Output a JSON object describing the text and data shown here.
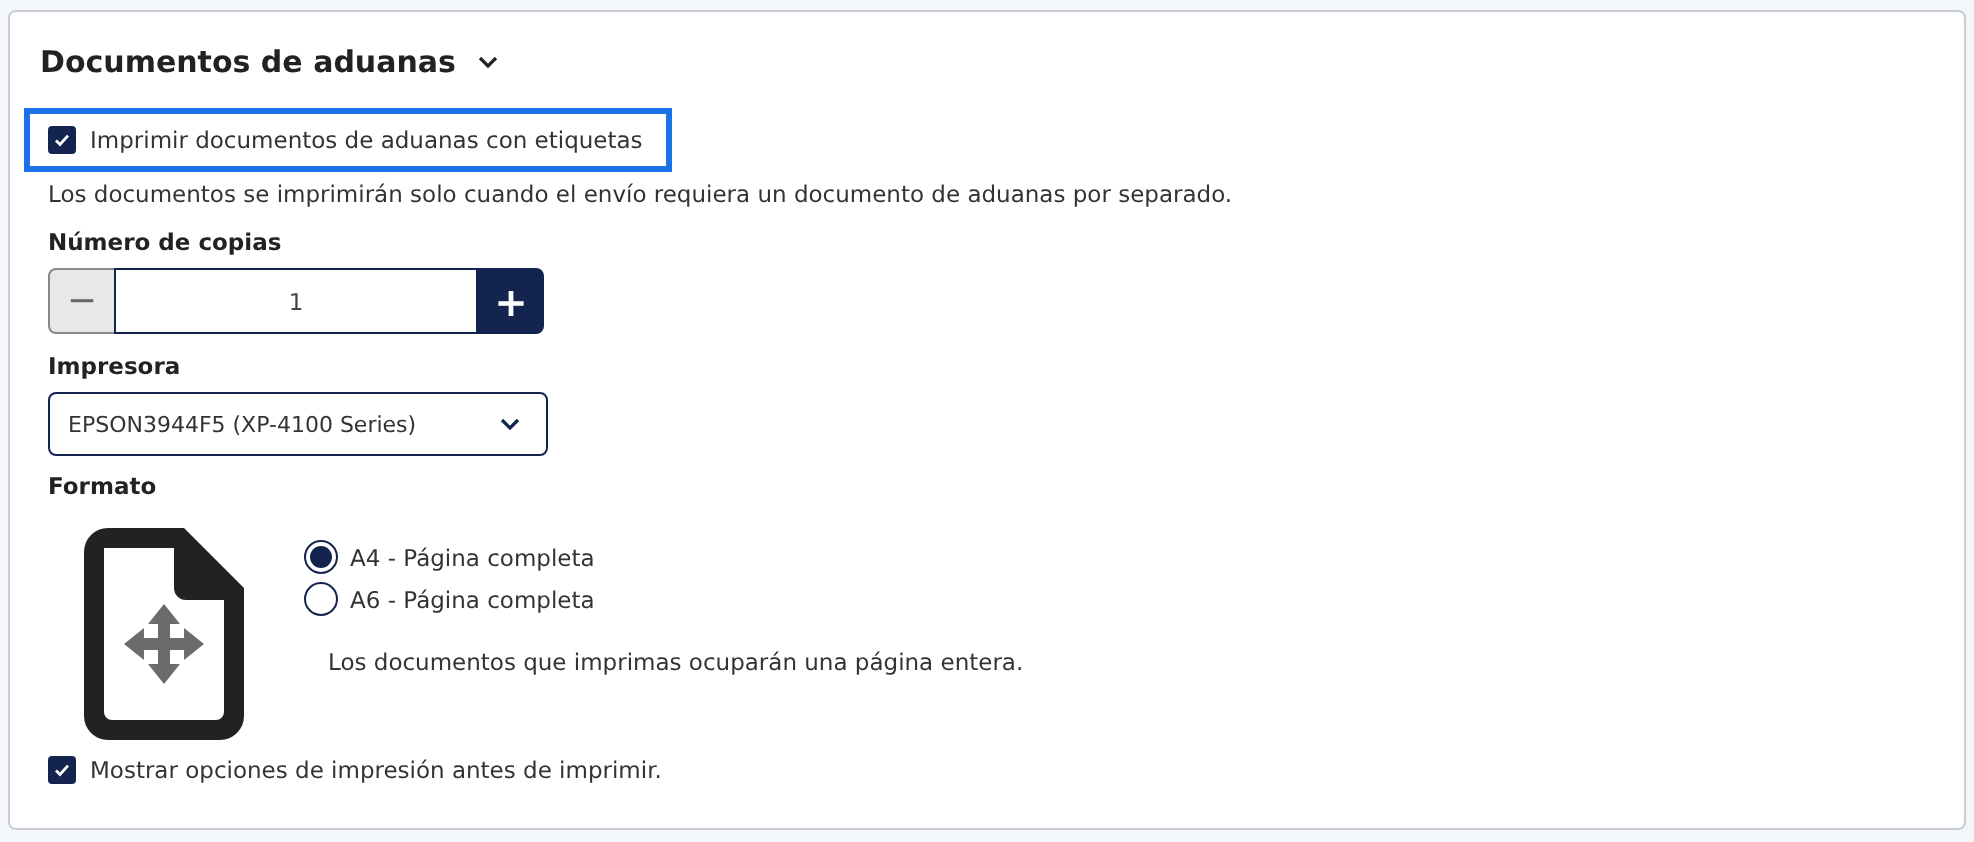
{
  "section": {
    "title": "Documentos de aduanas",
    "expanded": true
  },
  "print_with_labels": {
    "label": "Imprimir documentos de aduanas con etiquetas",
    "checked": true,
    "focused": true
  },
  "description": "Los documentos se imprimirán solo cuando el envío requiera un documento de aduanas por separado.",
  "copies": {
    "label": "Número de copias",
    "decrement": "−",
    "value": "1",
    "increment": "+"
  },
  "printer": {
    "label": "Impresora",
    "value": "EPSON3944F5 (XP-4100 Series)"
  },
  "format": {
    "label": "Formato",
    "options": [
      {
        "label": "A4 - Página completa",
        "selected": true
      },
      {
        "label": "A6 - Página completa",
        "selected": false
      }
    ],
    "note": "Los documentos que imprimas ocuparán una página entera."
  },
  "show_options": {
    "label": "Mostrar opciones de impresión antes de imprimir.",
    "checked": true
  }
}
